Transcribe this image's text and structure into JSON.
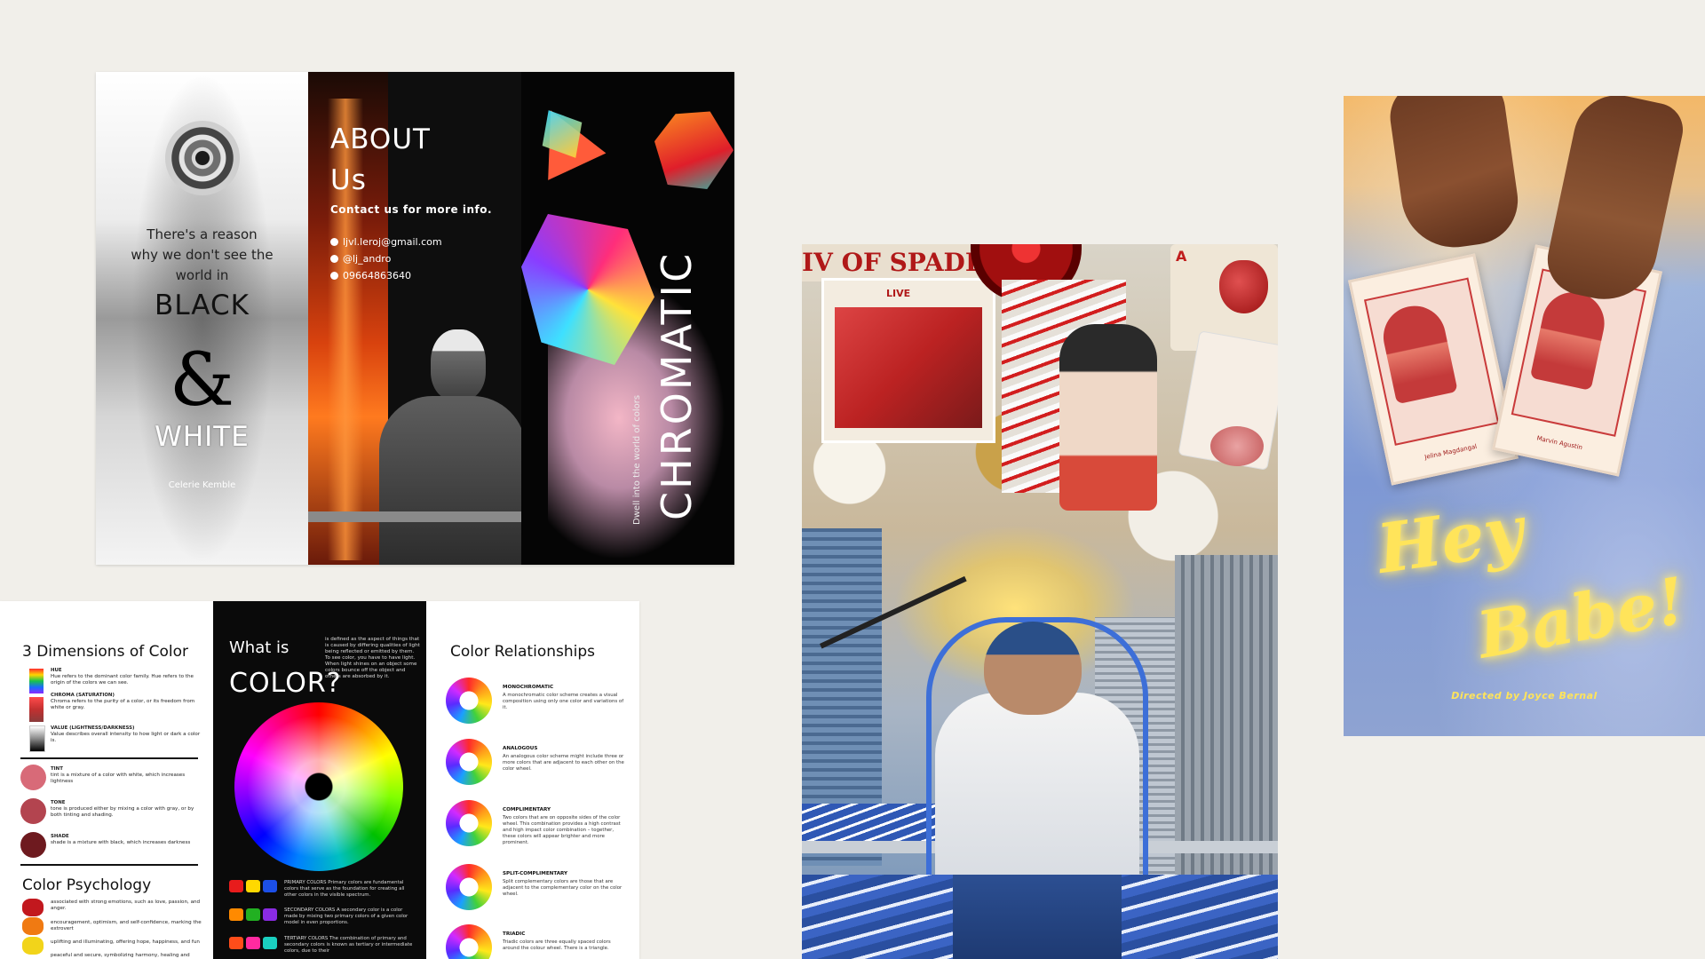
{
  "brochure_bw": {
    "left_panel": {
      "line1": "There's a reason",
      "line2": "why we don't see the",
      "line3": "world in",
      "black": "BLACK",
      "amp": "&",
      "white": "WHITE",
      "author": "Celerie Kemble"
    },
    "about_panel": {
      "title_line1": "ABOUT",
      "title_line2": "Us",
      "contact_heading": "Contact us for more info.",
      "email": "ljvl.leroj@gmail.com",
      "handle": "@lj_andro",
      "phone": "09664863640"
    },
    "chromatic_panel": {
      "title": "CHROMATIC",
      "subtitle": "Dwell into the world of colors"
    }
  },
  "brochure_color": {
    "dimensions": {
      "title": "3 Dimensions of Color",
      "items": [
        {
          "name": "HUE",
          "desc": "Hue refers to the dominant color family. Hue refers to the origin of the colors we can see."
        },
        {
          "name": "CHROMA (SATURATION)",
          "desc": "Chroma refers to the purity of a color, or its freedom from white or gray."
        },
        {
          "name": "VALUE (LIGHTNESS/DARKNESS)",
          "desc": "Value describes overall intensity to how light or dark a color is."
        }
      ],
      "tones": [
        {
          "name": "TINT",
          "desc": "tint is a mixture of a color with white, which increases lightness"
        },
        {
          "name": "TONE",
          "desc": "tone is produced either by mixing a color with gray, or by both tinting and shading."
        },
        {
          "name": "SHADE",
          "desc": "shade is a mixture with black, which increases darkness"
        }
      ],
      "psychology_title": "Color Psychology",
      "psychology": [
        "associated with strong emotions, such as love, passion, and anger.",
        "encouragement, optimism, and self-confidence, marking the extrovert",
        "uplifting and illuminating, offering hope, happiness, and fun",
        "peaceful and secure, symbolizing harmony, healing and"
      ]
    },
    "what_is": {
      "line1": "What is",
      "line2": "COLOR?",
      "desc": "is defined as the aspect of things that is caused by differing qualities of light being reflected or emitted by them. To see color, you have to have light. When light shines on an object some colors bounce off the object and others are absorbed by it.",
      "primary": "PRIMARY COLORS Primary colors are fundamental colors that serve as the foundation for creating all other colors in the visible spectrum.",
      "secondary": "SECONDARY COLORS A secondary color is a color made by mixing two primary colors of a given color model in even proportions.",
      "tertiary": "TERTIARY COLORS The combination of primary and secondary colors is known as tertiary or intermediate colors, due to their"
    },
    "relationships": {
      "title": "Color Relationships",
      "items": [
        {
          "name": "MONOCHROMATIC",
          "desc": "A monochromatic color scheme creates a visual composition using only one color and variations of it."
        },
        {
          "name": "ANALOGOUS",
          "desc": "An analogous color scheme might include three or more colors that are adjacent to each other on the color wheel."
        },
        {
          "name": "COMPLIMENTARY",
          "desc": "Two colors that are on opposite sides of the color wheel. This combination provides a high contrast and high impact color combination – together, these colors will appear brighter and more prominent."
        },
        {
          "name": "SPLIT-COMPLIMENTARY",
          "desc": "Split complementary colors are those that are adjacent to the complementary color on the color wheel."
        },
        {
          "name": "TRIADIC",
          "desc": "Triadic colors are three equally spaced colors around the colour wheel. There is a triangle."
        }
      ]
    }
  },
  "collage": {
    "banner": "IV OF SPADES",
    "live": "LIVE",
    "ace": "A"
  },
  "hey_babe": {
    "title_line1": "Hey",
    "title_line2": "Babe!",
    "card_left_name": "Jelina Magdangal",
    "card_right_name": "Marvin Agustin",
    "credit": "Directed by Joyce Bernal"
  },
  "colors": {
    "background": "#f1efea",
    "neon_yellow": "#ffe45a",
    "collage_blue": "#3d6fd8"
  }
}
